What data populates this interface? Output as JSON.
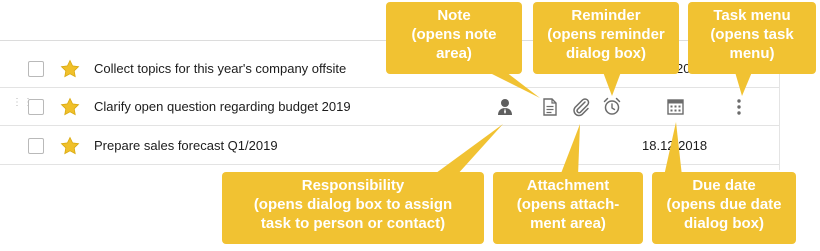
{
  "tasks": [
    {
      "title": "Collect topics for this year's company offsite",
      "due_date": "20",
      "starred": true
    },
    {
      "title": "Clarify open question regarding budget 2019",
      "due_date": "",
      "starred": true
    },
    {
      "title": "Prepare sales forecast Q1/2019",
      "due_date": "18.12.2018",
      "starred": true
    }
  ],
  "row_icons": [
    "person-icon",
    "note-icon",
    "paperclip-icon",
    "alarm-clock-icon",
    "calendar-icon",
    "kebab-menu-icon"
  ],
  "callouts": {
    "note": {
      "title": "Note",
      "sub": "(opens note area)",
      "line1": "(opens note",
      "line2": "area)"
    },
    "reminder": {
      "title": "Reminder",
      "line1": "(opens reminder",
      "line2": "dialog box)"
    },
    "task_menu": {
      "title": "Task menu",
      "line1": "(opens task",
      "line2": "menu)"
    },
    "responsibility": {
      "title": "Responsibility",
      "line1": "(opens dialog box to assign",
      "line2": "task to person or contact)"
    },
    "attachment": {
      "title": "Attachment",
      "line1": "(opens attach-",
      "line2": "ment area)"
    },
    "due_date": {
      "title": "Due date",
      "line1": "(opens due date",
      "line2": "dialog box)"
    }
  },
  "colors": {
    "callout": "#f1c232",
    "star": "#f0c02a",
    "icon": "#666666"
  }
}
